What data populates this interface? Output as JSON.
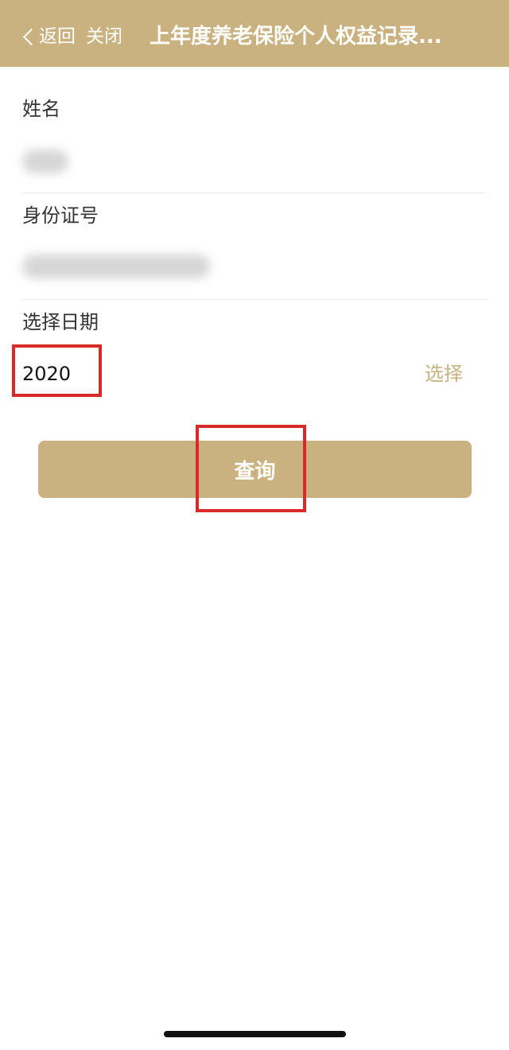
{
  "theme": {
    "accent": "#c9b27f",
    "highlight": "#d92a2a"
  },
  "navbar": {
    "back_icon": "chevron-left-icon",
    "back_label": "返回",
    "close_label": "关闭",
    "title": "上年度养老保险个人权益记录..."
  },
  "form": {
    "name": {
      "label": "姓名"
    },
    "id_number": {
      "label": "身份证号"
    },
    "date": {
      "label": "选择日期",
      "value": "2020",
      "select_label": "选择"
    }
  },
  "submit_label": "查询"
}
